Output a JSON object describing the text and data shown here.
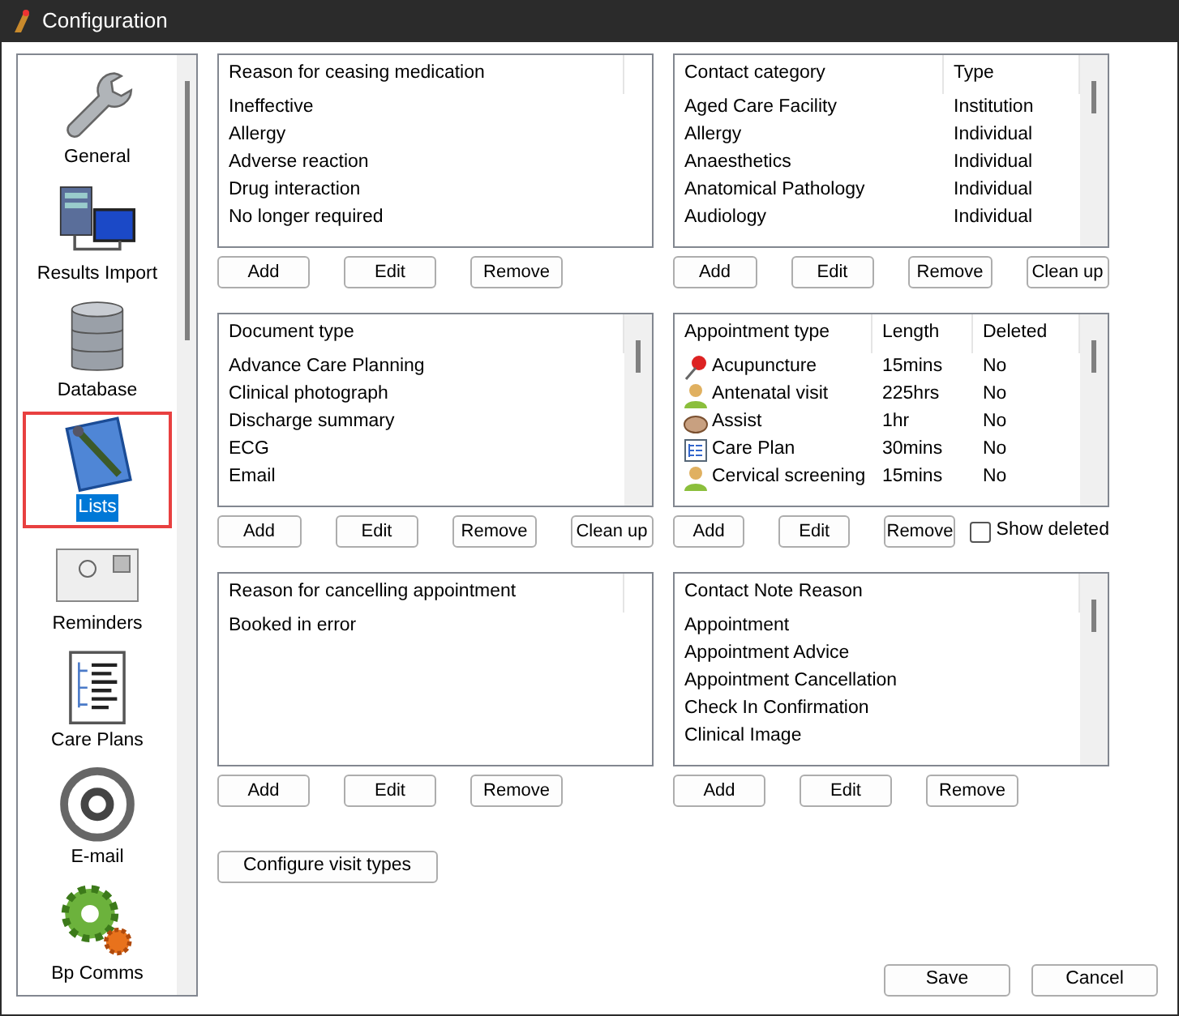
{
  "window": {
    "title": "Configuration"
  },
  "sidebar": {
    "items": [
      {
        "label": "General",
        "selected": false
      },
      {
        "label": "Results Import",
        "selected": false
      },
      {
        "label": "Database",
        "selected": false
      },
      {
        "label": "Lists",
        "selected": true
      },
      {
        "label": "Reminders",
        "selected": false
      },
      {
        "label": "Care Plans",
        "selected": false
      },
      {
        "label": "E-mail",
        "selected": false
      },
      {
        "label": "Bp Comms",
        "selected": false
      }
    ]
  },
  "lists": [
    {
      "columns": [
        "Reason for ceasing medication"
      ],
      "rows": [
        {
          "cells": [
            "Ineffective"
          ]
        },
        {
          "cells": [
            "Allergy"
          ]
        },
        {
          "cells": [
            "Adverse reaction"
          ]
        },
        {
          "cells": [
            "Drug interaction"
          ]
        },
        {
          "cells": [
            "No longer required"
          ]
        }
      ],
      "buttons": [
        "Add",
        "Edit",
        "Remove"
      ]
    },
    {
      "columns": [
        "Contact category",
        "Type"
      ],
      "rows": [
        {
          "cells": [
            "Aged Care Facility",
            "Institution"
          ]
        },
        {
          "cells": [
            "Allergy",
            "Individual"
          ]
        },
        {
          "cells": [
            "Anaesthetics",
            "Individual"
          ]
        },
        {
          "cells": [
            "Anatomical Pathology",
            "Individual"
          ]
        },
        {
          "cells": [
            "Audiology",
            "Individual"
          ]
        }
      ],
      "buttons": [
        "Add",
        "Edit",
        "Remove",
        "Clean up"
      ]
    },
    {
      "columns": [
        "Document type"
      ],
      "rows": [
        {
          "cells": [
            "Advance Care Planning"
          ]
        },
        {
          "cells": [
            "Clinical photograph"
          ]
        },
        {
          "cells": [
            "Discharge summary"
          ]
        },
        {
          "cells": [
            "ECG"
          ]
        },
        {
          "cells": [
            "Email"
          ]
        }
      ],
      "buttons": [
        "Add",
        "Edit",
        "Remove",
        "Clean up"
      ]
    },
    {
      "columns": [
        "Appointment type",
        "Length",
        "Deleted"
      ],
      "rows": [
        {
          "cells": [
            "Acupuncture",
            "15mins",
            "No"
          ]
        },
        {
          "cells": [
            "Antenatal visit",
            "225hrs",
            "No"
          ]
        },
        {
          "cells": [
            "Assist",
            "1hr",
            "No"
          ]
        },
        {
          "cells": [
            "Care Plan",
            "30mins",
            "No"
          ]
        },
        {
          "cells": [
            "Cervical screening",
            "15mins",
            "No"
          ]
        }
      ],
      "buttons": [
        "Add",
        "Edit",
        "Remove"
      ],
      "checkbox": {
        "label": "Show deleted",
        "checked": false
      }
    },
    {
      "columns": [
        "Reason for cancelling appointment"
      ],
      "rows": [
        {
          "cells": [
            "Booked in error"
          ]
        }
      ],
      "buttons": [
        "Add",
        "Edit",
        "Remove"
      ]
    },
    {
      "columns": [
        "Contact Note Reason"
      ],
      "rows": [
        {
          "cells": [
            "Appointment"
          ]
        },
        {
          "cells": [
            "Appointment Advice"
          ]
        },
        {
          "cells": [
            "Appointment Cancellation"
          ]
        },
        {
          "cells": [
            "Check In Confirmation"
          ]
        },
        {
          "cells": [
            "Clinical Image"
          ]
        }
      ],
      "buttons": [
        "Add",
        "Edit",
        "Remove"
      ]
    }
  ],
  "configure_button": "Configure visit types",
  "footer_buttons": [
    "Save",
    "Cancel"
  ]
}
